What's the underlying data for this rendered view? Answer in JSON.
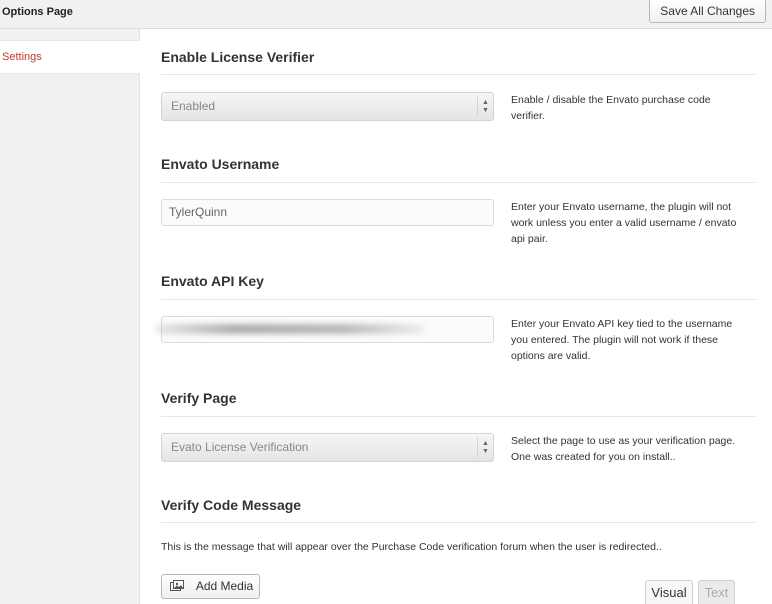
{
  "header": {
    "title": "Options Page",
    "save_label": "Save All Changes"
  },
  "sidebar": {
    "items": [
      {
        "label": "Settings",
        "active": true,
        "color": "#c0392b"
      }
    ]
  },
  "sections": {
    "license": {
      "title": "Enable License Verifier",
      "value": "Enabled",
      "description": "Enable / disable the Envato purchase code verifier."
    },
    "username": {
      "title": "Envato Username",
      "value": "TylerQuinn",
      "description": "Enter your Envato username, the plugin will not work unless you enter a valid username / envato api pair."
    },
    "apikey": {
      "title": "Envato API Key",
      "value": "",
      "description": "Enter your Envato API key tied to the username you entered. The plugin will not work if these options are valid."
    },
    "verify_page": {
      "title": "Verify Page",
      "value": "Evato License Verification",
      "description": "Select the page to use as your verification page. One was created for you on install.."
    },
    "verify_message": {
      "title": "Verify Code Message",
      "description": "This is the message that will appear over the Purchase Code verification forum when the user is redirected.."
    }
  },
  "editor": {
    "add_media_label": "Add Media",
    "tabs": [
      "Visual",
      "Text"
    ],
    "active_tab": "Visual"
  }
}
